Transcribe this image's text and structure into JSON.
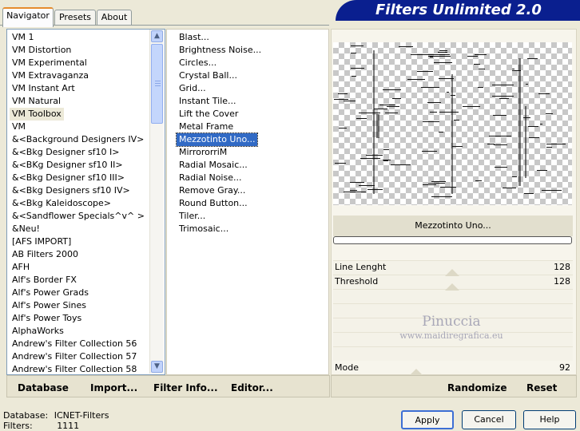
{
  "window": {
    "title": "Filters Unlimited 2.0",
    "tabs": [
      "Navigator",
      "Presets",
      "About"
    ],
    "active_tab": "Navigator"
  },
  "categories": [
    "VM 1",
    "VM Distortion",
    "VM Experimental",
    "VM Extravaganza",
    "VM Instant Art",
    "VM Natural",
    "VM Toolbox",
    "VM",
    "&<Background Designers IV>",
    "&<Bkg Designer sf10 I>",
    "&<BKg Designer sf10 II>",
    "&<Bkg Designer sf10 III>",
    "&<Bkg Designers sf10 IV>",
    "&<Bkg Kaleidoscope>",
    "&<Sandflower Specials^v^ >",
    "&Neu!",
    "[AFS IMPORT]",
    "AB Filters 2000",
    "AFH",
    "Alf's Border FX",
    "Alf's Power Grads",
    "Alf's Power Sines",
    "Alf's Power Toys",
    "AlphaWorks",
    "Andrew's Filter Collection 56",
    "Andrew's Filter Collection 57",
    "Andrew's Filter Collection 58"
  ],
  "selected_category": "VM Toolbox",
  "filters": [
    "Blast...",
    "Brightness Noise...",
    "Circles...",
    "Crystal Ball...",
    "Grid...",
    "Instant Tile...",
    "Lift the Cover",
    "Metal Frame",
    "Mezzotinto Uno...",
    "MirrororriM",
    "Radial Mosaic...",
    "Radial Noise...",
    "Remove Gray...",
    "Round Button...",
    "Tiler...",
    "Trimosaic..."
  ],
  "selected_filter": "Mezzotinto Uno...",
  "left_buttons": {
    "database": "Database",
    "import": "Import...",
    "filter_info": "Filter Info...",
    "editor": "Editor..."
  },
  "preview": {
    "filter_name": "Mezzotinto Uno...",
    "progress": 0
  },
  "parameters": [
    {
      "name": "Line Lenght",
      "value": "128"
    },
    {
      "name": "Threshold",
      "value": "128"
    }
  ],
  "mode": {
    "name": "Mode",
    "value": "92"
  },
  "watermark": {
    "line1": "Pinuccia",
    "line2": "www.maidiregrafica.eu"
  },
  "right_buttons": {
    "randomize": "Randomize",
    "reset": "Reset"
  },
  "status": {
    "database_label": "Database:",
    "database_value": "ICNET-Filters",
    "filters_label": "Filters:",
    "filters_value": "1111"
  },
  "dialog_buttons": {
    "apply": "Apply",
    "cancel": "Cancel",
    "help": "Help"
  },
  "colors": {
    "banner": "#0a1f8f",
    "selection": "#316ac5",
    "window_bg": "#ece9d8"
  }
}
